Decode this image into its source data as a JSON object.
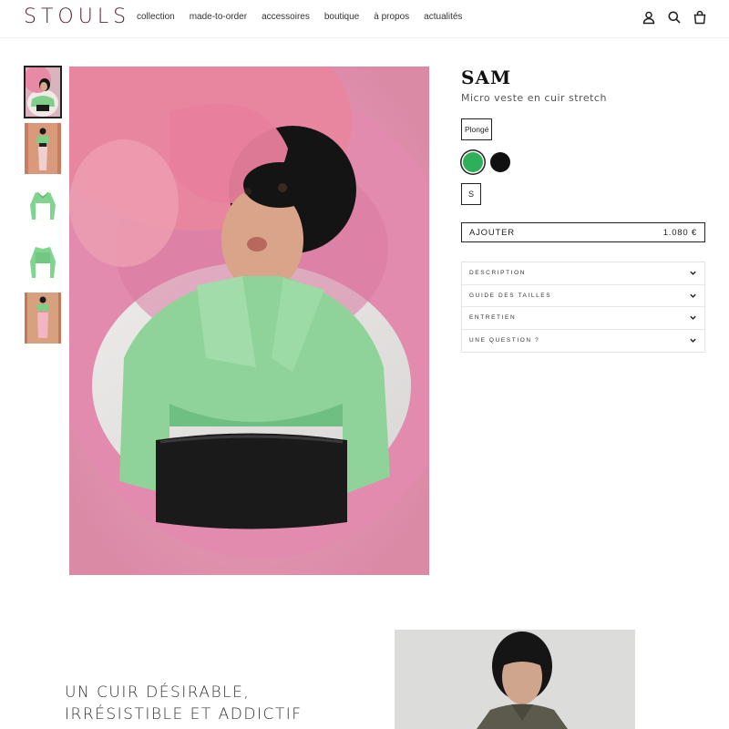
{
  "header": {
    "logo": "STOULS",
    "nav": [
      "collection",
      "made-to-order",
      "accessoires",
      "boutique",
      "à propos",
      "actualités"
    ],
    "icons": [
      "account-icon",
      "search-icon",
      "cart-icon"
    ]
  },
  "gallery": {
    "thumbnails": [
      "model-green-jacket-closeup",
      "model-green-jacket-full",
      "green-jacket-front",
      "green-jacket-back",
      "model-green-jacket-pink-pants"
    ],
    "active_index": 0
  },
  "product": {
    "title": "SAM",
    "subtitle": "Micro veste en cuir stretch",
    "material_option": "Plongé",
    "colors": [
      {
        "name": "green",
        "hex": "#2eb05a",
        "selected": true
      },
      {
        "name": "black",
        "hex": "#111111",
        "selected": false
      }
    ],
    "size": "S",
    "add_label": "AJOUTER",
    "price": "1.080 €"
  },
  "accordion": [
    "DESCRIPTION",
    "GUIDE DES TAILLES",
    "ENTRETIEN",
    "UNE QUESTION ?"
  ],
  "feature": {
    "tagline_line1": "UN CUIR DÉSIRABLE,",
    "tagline_line2": "IRRÉSISTIBLE ET ADDICTIF"
  },
  "colors": {
    "brand": "#5a1f35",
    "jacket_green": "#7fcf8a",
    "pink": "#e98aa8"
  }
}
